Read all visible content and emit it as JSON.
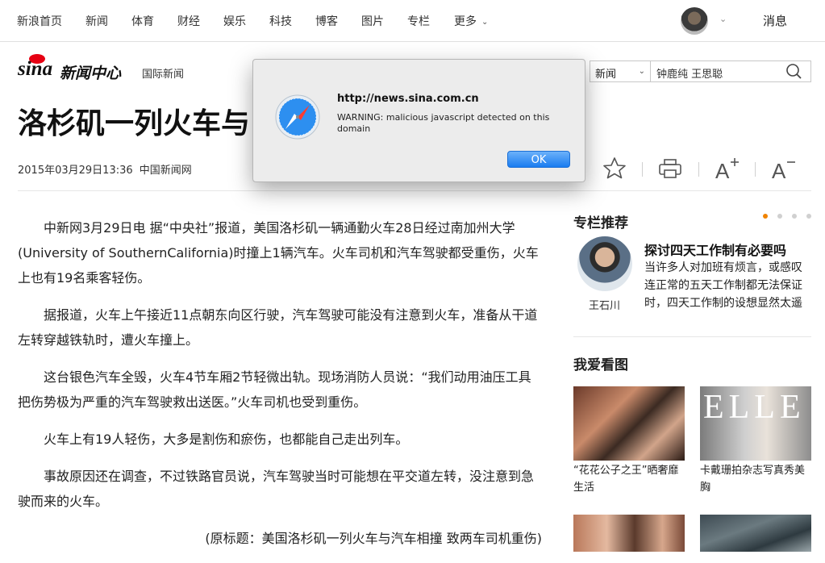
{
  "topnav": {
    "items": [
      "新浪首页",
      "新闻",
      "体育",
      "财经",
      "娱乐",
      "科技",
      "博客",
      "图片",
      "专栏",
      "更多"
    ],
    "messages_label": "消息"
  },
  "brand": {
    "logo_text": "sina",
    "section_name": "新闻中心",
    "channel": "国际新闻"
  },
  "search": {
    "category": "新闻",
    "query": "钟鹿纯 王思聪"
  },
  "article": {
    "headline": "洛杉矶一列火车与",
    "date": "2015年03月29日13:36",
    "source": "中国新闻网",
    "paragraphs": [
      "中新网3月29日电 据“中央社”报道，美国洛杉矶一辆通勤火车28日经过南加州大学(University of SouthernCalifornia)时撞上1辆汽车。火车司机和汽车驾驶都受重伤，火车上也有19名乘客轻伤。",
      "据报道，火车上午接近11点朝东向区行驶，汽车驾驶可能没有注意到火车，准备从干道左转穿越铁轨时，遭火车撞上。",
      "这台银色汽车全毁，火车4节车厢2节轻微出轨。现场消防人员说：“我们动用油压工具把伤势极为严重的汽车驾驶救出送医。”火车司机也受到重伤。",
      "火车上有19人轻伤，大多是割伤和瘀伤，也都能自己走出列车。",
      "事故原因还在调查，不过铁路官员说，汽车驾驶当时可能想在平交道左转，没注意到急驶而来的火车。"
    ],
    "original_title": "(原标题：美国洛杉矶一列火车与汽车相撞 致两车司机重伤)"
  },
  "sidebar": {
    "column_title": "专栏推荐",
    "columnist": {
      "name": "王石川",
      "title": "探讨四天工作制有必要吗",
      "desc": "当许多人对加班有烦言，或感叹连正常的五天工作制都无法保证时，四天工作制的设想显然太遥远。有"
    },
    "photo_title": "我爱看图",
    "photos": [
      {
        "caption": "“花花公子之王”晒奢靡生活"
      },
      {
        "caption": "卡戴珊拍杂志写真秀美胸"
      }
    ]
  },
  "dialog": {
    "title": "http://news.sina.com.cn",
    "message": "WARNING: malicious javascript detected on this domain",
    "ok_label": "OK"
  },
  "colors": {
    "accent_red": "#e60012",
    "dot_active": "#f08300",
    "button_blue": "#1a7cf0"
  }
}
